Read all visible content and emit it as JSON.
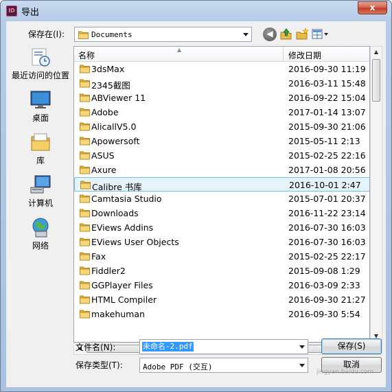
{
  "window": {
    "title": "导出",
    "app_icon_text": "ID",
    "close_glyph": "x"
  },
  "lookin": {
    "label": "保存在(I):",
    "value": "Documents"
  },
  "toolbar": {
    "back_glyph": "◀"
  },
  "places": [
    {
      "label": "最近访问的位置",
      "icon": "recent-places-icon"
    },
    {
      "label": "桌面",
      "icon": "desktop-icon"
    },
    {
      "label": "库",
      "icon": "libraries-icon"
    },
    {
      "label": "计算机",
      "icon": "computer-icon"
    },
    {
      "label": "网络",
      "icon": "network-icon"
    }
  ],
  "columns": {
    "name": "名称",
    "date": "修改日期"
  },
  "files": [
    {
      "name": "3dsMax",
      "date": "2016-09-30 11:19"
    },
    {
      "name": "2345截图",
      "date": "2016-03-11 15:48"
    },
    {
      "name": "ABViewer 11",
      "date": "2016-09-22 15:04"
    },
    {
      "name": "Adobe",
      "date": "2017-01-14 13:07"
    },
    {
      "name": "AlicallV5.0",
      "date": "2015-09-30 21:06"
    },
    {
      "name": "Apowersoft",
      "date": "2015-05-11 2:13"
    },
    {
      "name": "ASUS",
      "date": "2015-02-25 22:16"
    },
    {
      "name": "Axure",
      "date": "2017-01-08 20:56"
    },
    {
      "name": "Calibre 书库",
      "date": "2016-10-01 2:47"
    },
    {
      "name": "Camtasia Studio",
      "date": "2015-07-01 20:37"
    },
    {
      "name": "Downloads",
      "date": "2016-11-22 23:14"
    },
    {
      "name": "EViews Addins",
      "date": "2016-07-30 16:03"
    },
    {
      "name": "EViews User Objects",
      "date": "2016-07-30 16:03"
    },
    {
      "name": "Fax",
      "date": "2015-02-25 22:17"
    },
    {
      "name": "Fiddler2",
      "date": "2015-09-08 1:29"
    },
    {
      "name": "GGPlayer Files",
      "date": "2016-03-09 2:33"
    },
    {
      "name": "HTML Compiler",
      "date": "2016-09-30 21:27"
    },
    {
      "name": "makehuman",
      "date": "2016-09-30 5:54"
    }
  ],
  "hover_index": 8,
  "filename": {
    "label": "文件名(N):",
    "value": "未命名-2.pdf"
  },
  "filetype": {
    "label": "保存类型(T):",
    "value": "Adobe PDF (交互)"
  },
  "buttons": {
    "save": "保存(S)",
    "cancel": "取消"
  },
  "watermark": "jingyan.baidu.com"
}
